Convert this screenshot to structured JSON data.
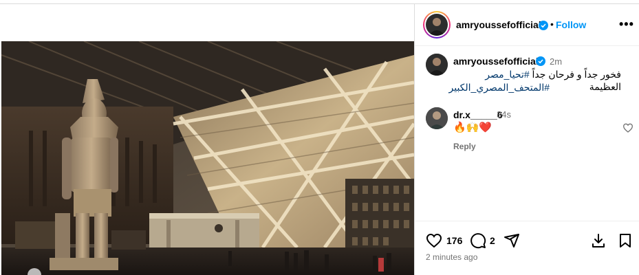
{
  "post": {
    "author": "amryoussefofficial",
    "follow_label": "Follow",
    "more_label": "•••",
    "caption_time": "2m",
    "caption_line1": "فخور جداً و فرحان جداً",
    "caption_hashtag1": "#تحيا_مصر",
    "caption_word": "العظيمة",
    "caption_hashtag2": "#المتحف_المصري_الكبير",
    "posted_ago": "2 minutes ago"
  },
  "comment": {
    "author": "dr.x_____6",
    "time": "34s",
    "text": "🔥🙌❤️",
    "reply_label": "Reply"
  },
  "stats": {
    "likes": "176",
    "comments": "2"
  },
  "icons": {
    "verified": "verified-badge-icon",
    "like": "heart-icon",
    "comment": "comment-icon",
    "share": "share-icon",
    "download": "download-icon",
    "save": "bookmark-icon"
  },
  "colors": {
    "accent": "#0095f6",
    "verified": "#0095f6",
    "hashtag": "#00376b",
    "muted": "#737373"
  }
}
